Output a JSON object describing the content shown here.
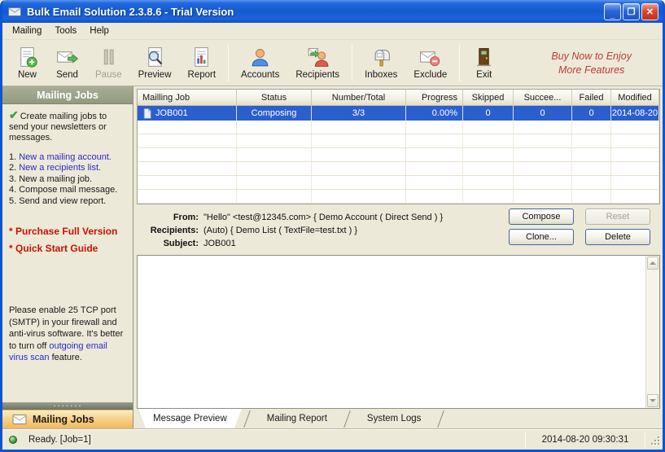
{
  "window": {
    "title": "Bulk Email Solution 2.3.8.6 - Trial Version",
    "controls": [
      {
        "name": "minimize-button",
        "glyph": "_"
      },
      {
        "name": "maximize-button",
        "glyph": "❐"
      },
      {
        "name": "close-button",
        "glyph": "✕"
      }
    ]
  },
  "menu": {
    "items": [
      "Mailing",
      "Tools",
      "Help"
    ]
  },
  "toolbar": {
    "groups": [
      {
        "buttons": [
          {
            "label": "New",
            "icon": "new-document-icon",
            "enabled": true
          },
          {
            "label": "Send",
            "icon": "send-mail-icon",
            "enabled": true
          },
          {
            "label": "Pause",
            "icon": "pause-icon",
            "enabled": false
          },
          {
            "label": "Preview",
            "icon": "preview-icon",
            "enabled": true
          },
          {
            "label": "Report",
            "icon": "report-icon",
            "enabled": true
          }
        ]
      },
      {
        "buttons": [
          {
            "label": "Accounts",
            "icon": "accounts-icon",
            "enabled": true
          },
          {
            "label": "Recipients",
            "icon": "recipients-icon",
            "enabled": true
          }
        ]
      },
      {
        "buttons": [
          {
            "label": "Inboxes",
            "icon": "inboxes-icon",
            "enabled": true
          },
          {
            "label": "Exclude",
            "icon": "exclude-mail-icon",
            "enabled": true
          }
        ]
      },
      {
        "buttons": [
          {
            "label": "Exit",
            "icon": "exit-door-icon",
            "enabled": true
          }
        ]
      }
    ],
    "promo": {
      "line1": "Buy Now to Enjoy",
      "line2": "More Features"
    }
  },
  "sidebar": {
    "header": "Mailing Jobs",
    "intro": "Create mailing jobs to send your newsletters or messages.",
    "steps": [
      {
        "num": "1.",
        "label": "New a mailing account.",
        "link": true
      },
      {
        "num": "2.",
        "label": "New a recipients list.",
        "link": true
      },
      {
        "num": "3.",
        "label": "New a mailing job.",
        "link": false
      },
      {
        "num": "4.",
        "label": "Compose mail message.",
        "link": false
      },
      {
        "num": "5.",
        "label": "Send and view report.",
        "link": false
      }
    ],
    "promo_links": [
      "* Purchase Full Version",
      "* Quick Start Guide"
    ],
    "note": {
      "before": "Please enable 25 TCP port (SMTP) in your firewall and anti-virus software. It's better to turn off ",
      "link": "outgoing email virus scan",
      "after": " feature."
    },
    "bottom_button": "Mailing Jobs"
  },
  "jobs_table": {
    "columns": [
      "Mailling Job",
      "Status",
      "Number/Total",
      "Progress",
      "Skipped",
      "Succee...",
      "Failed",
      "Modified"
    ],
    "rows": [
      {
        "cells": [
          "JOB001",
          "Composing",
          "3/3",
          "0.00%",
          "0",
          "0",
          "0",
          "2014-08-20"
        ],
        "selected": true
      }
    ]
  },
  "details": {
    "fields": [
      {
        "label": "From:",
        "value": "\"Hello\" <test@12345.com> { Demo Account ( Direct Send ) }"
      },
      {
        "label": "Recipients:",
        "value": "(Auto) { Demo List ( TextFile=test.txt ) }"
      },
      {
        "label": "Subject:",
        "value": "JOB001"
      }
    ],
    "buttons": [
      {
        "label": "Compose",
        "enabled": true
      },
      {
        "label": "Reset",
        "enabled": false
      },
      {
        "label": "Clone...",
        "enabled": true
      },
      {
        "label": "Delete",
        "enabled": true
      }
    ]
  },
  "tabs": [
    {
      "label": "Message Preview",
      "active": true
    },
    {
      "label": "Mailing Report",
      "active": false
    },
    {
      "label": "System Logs",
      "active": false
    }
  ],
  "statusbar": {
    "left": "Ready. [Job=1]",
    "right": "2014-08-20 09:30:31"
  },
  "colors": {
    "selection_blue": "#2B5FCE",
    "link_blue": "#2A2ACC",
    "alert_red": "#CC1100",
    "promo_red": "#C23A3A",
    "sidebar_header_bg": "#9DA38B",
    "titlebar_blue": "#1A5CD6",
    "panel_tan": "#ECE9D8"
  }
}
